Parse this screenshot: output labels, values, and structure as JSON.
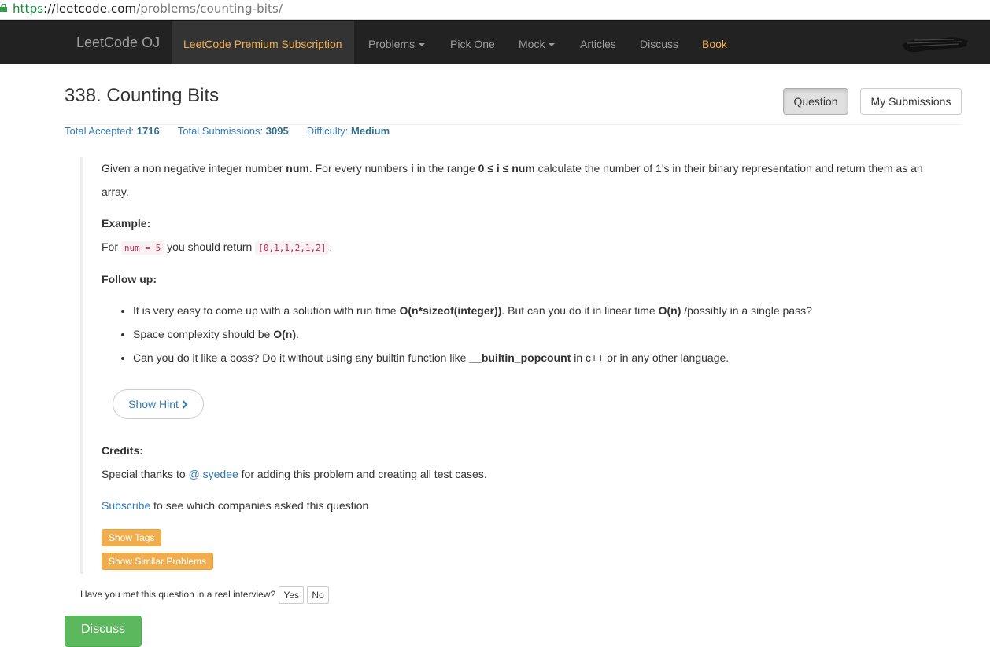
{
  "browser": {
    "url_scheme": "https",
    "url_sep": "://",
    "url_host": "leetcode.com",
    "url_path": "/problems/counting-bits/"
  },
  "nav": {
    "brand": "LeetCode OJ",
    "premium": "LeetCode Premium Subscription",
    "problems": "Problems",
    "pick_one": "Pick One",
    "mock": "Mock",
    "articles": "Articles",
    "discuss": "Discuss",
    "book": "Book"
  },
  "problem": {
    "title": "338. Counting Bits",
    "tab_question": "Question",
    "tab_submissions": "My Submissions",
    "total_accepted_label": "Total Accepted:",
    "total_accepted": "1716",
    "total_submissions_label": "Total Submissions:",
    "total_submissions": "3095",
    "difficulty_label": "Difficulty:",
    "difficulty": "Medium"
  },
  "description": {
    "p1_a": "Given a non negative integer number ",
    "p1_num": "num",
    "p1_b": ". For every numbers ",
    "p1_i": "i",
    "p1_c": " in the range ",
    "p1_range": "0 ≤ i ≤ num",
    "p1_d": " calculate the number of 1's in their binary representation and return them as an",
    "p1_e": "array.",
    "example_heading": "Example:",
    "example_for": "For ",
    "example_code1": "num = 5",
    "example_mid": " you should return ",
    "example_code2": "[0,1,1,2,1,2]",
    "example_end": ".",
    "followup_heading": "Follow up:",
    "f1_a": "It is very easy to come up with a solution with run time ",
    "f1_b": "O(n*sizeof(integer))",
    "f1_c": ". But can you do it in linear time ",
    "f1_d": "O(n)",
    "f1_e": " /possibly in a single pass?",
    "f2_a": "Space complexity should be ",
    "f2_b": "O(n)",
    "f2_c": ".",
    "f3_a": "Can you do it like a boss? Do it without using any builtin function like ",
    "f3_b": "__builtin_popcount",
    "f3_c": " in c++ or in any other language.",
    "show_hint": "Show Hint",
    "credits_heading": "Credits:",
    "credits_a": "Special thanks to ",
    "credits_link": "@ syedee",
    "credits_b": " for adding this problem and creating all test cases.",
    "subscribe_link": "Subscribe",
    "subscribe_rest": " to see which companies asked this question",
    "show_tags": "Show Tags",
    "show_similar": "Show Similar Problems"
  },
  "interview": {
    "question": "Have you met this question in a real interview?",
    "yes": "Yes",
    "no": "No"
  },
  "footer": {
    "discuss_button": "Discuss"
  }
}
